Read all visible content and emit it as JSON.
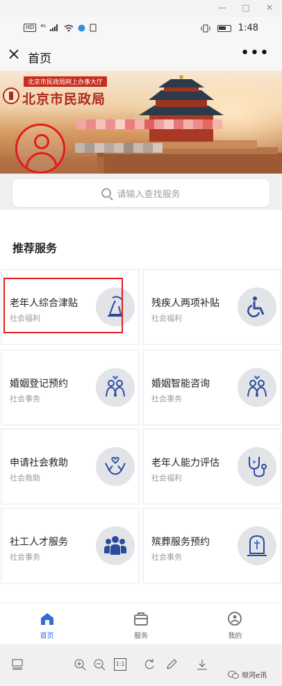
{
  "window": {
    "minimize": "—",
    "restore": "□",
    "close": "✕"
  },
  "statusbar": {
    "left_tags": [
      "HD",
      "⁴ᴳ"
    ],
    "time": "1:48"
  },
  "header": {
    "title": "首页",
    "close_icon": "close-icon",
    "more": "•••"
  },
  "banner": {
    "org_tag": "北京市民政局网上办事大厅",
    "org_name": "北京市民政局"
  },
  "search": {
    "placeholder": "请输入查找服务"
  },
  "section": {
    "title": "推荐服务"
  },
  "services": [
    {
      "name": "老年人综合津贴",
      "category": "社会福利",
      "icon": "elder-care-icon"
    },
    {
      "name": "残疾人两项补贴",
      "category": "社会福利",
      "icon": "wheelchair-icon"
    },
    {
      "name": "婚姻登记预约",
      "category": "社会事务",
      "icon": "couple-icon"
    },
    {
      "name": "婚姻智能咨询",
      "category": "社会事务",
      "icon": "couple-icon"
    },
    {
      "name": "申请社会救助",
      "category": "社会救助",
      "icon": "helping-hands-icon"
    },
    {
      "name": "老年人能力评估",
      "category": "社会福利",
      "icon": "stethoscope-icon"
    },
    {
      "name": "社工人才服务",
      "category": "社会事务",
      "icon": "group-icon"
    },
    {
      "name": "殡葬服务预约",
      "category": "社会事务",
      "icon": "tombstone-icon"
    }
  ],
  "bottom_nav": [
    {
      "label": "首页",
      "icon": "home-icon",
      "active": true
    },
    {
      "label": "服务",
      "icon": "briefcase-icon",
      "active": false
    },
    {
      "label": "我的",
      "icon": "profile-icon",
      "active": false
    }
  ],
  "viewer": {
    "zoom_label": "1:1"
  },
  "watermark": {
    "text": "坝河e讯"
  },
  "colors": {
    "accent": "#2f6fd4",
    "icon_blue": "#2b4b9b",
    "highlight": "#e31b1b",
    "banner_red": "#c62d1f"
  }
}
